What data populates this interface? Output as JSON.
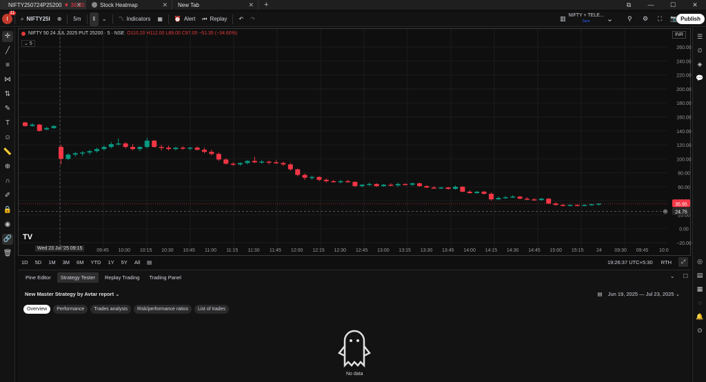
{
  "browser": {
    "tabs": [
      {
        "label": "NIFTY250724P25200",
        "price": "▼ 36.20",
        "active": true
      },
      {
        "label": "Stock Heatmap",
        "active": false
      },
      {
        "label": "New Tab",
        "active": false
      }
    ],
    "new_tab": "+"
  },
  "toolbar": {
    "avatar_letter": "I",
    "notifications": "11",
    "symbol": "NIFTY25I",
    "interval": "5m",
    "indicators": "Indicators",
    "alert": "Alert",
    "replay": "Replay",
    "layout_name": "NIFTY + TELE...",
    "layout_sub": "Save",
    "publish": "Publish"
  },
  "chart": {
    "legend_title": "NIFTY 50 24 JUL 2025 PUT 25200 · 5 · NSE",
    "ohlc": "O110.20 H112.00 L89.00 C97.05 −51.35 (−34.60%)",
    "interval_box": "5",
    "currency": "INR",
    "price_labels": [
      "260.00",
      "240.00",
      "220.00",
      "200.00",
      "180.00",
      "160.00",
      "140.00",
      "120.00",
      "100.00",
      "80.00",
      "60.00",
      "40.00",
      "20.00",
      "0.00",
      "−20.00"
    ],
    "last_price": "35.95",
    "crosshair_price": "24.75",
    "time_labels": [
      "09:45",
      "10:00",
      "10:15",
      "10:30",
      "10:45",
      "11:00",
      "11:15",
      "11:30",
      "11:45",
      "12:00",
      "12:15",
      "12:30",
      "12:45",
      "13:00",
      "13:15",
      "13:30",
      "13:45",
      "14:00",
      "14:15",
      "14:30",
      "14:45",
      "15:00",
      "15:15",
      "24",
      "09:30",
      "09:45",
      "10:0"
    ],
    "crosshair_date": "Wed 23 Jul '25   09:15",
    "colors": {
      "up": "#089981",
      "down": "#f23645"
    }
  },
  "chart_data": {
    "type": "candlestick",
    "ylim": [
      -20,
      270
    ],
    "candles": [
      [
        152,
        153,
        146,
        147,
        "d"
      ],
      [
        147,
        151,
        146,
        149,
        "u"
      ],
      [
        149,
        150,
        139,
        140,
        "d"
      ],
      [
        142,
        146,
        141,
        144,
        "u"
      ],
      [
        144,
        148,
        143,
        147,
        "u"
      ],
      [
        117,
        120,
        92,
        100,
        "d"
      ],
      [
        100,
        108,
        98,
        106,
        "u"
      ],
      [
        106,
        110,
        103,
        108,
        "u"
      ],
      [
        108,
        111,
        104,
        109,
        "u"
      ],
      [
        109,
        113,
        106,
        111,
        "u"
      ],
      [
        111,
        116,
        109,
        114,
        "u"
      ],
      [
        114,
        119,
        112,
        117,
        "u"
      ],
      [
        117,
        124,
        115,
        121,
        "u"
      ],
      [
        121,
        129,
        119,
        122,
        "u"
      ],
      [
        122,
        124,
        115,
        117,
        "d"
      ],
      [
        117,
        121,
        112,
        114,
        "d"
      ],
      [
        114,
        118,
        111,
        117,
        "u"
      ],
      [
        117,
        130,
        115,
        126,
        "u"
      ],
      [
        126,
        127,
        116,
        117,
        "d"
      ],
      [
        117,
        120,
        112,
        116,
        "d"
      ],
      [
        116,
        119,
        112,
        114,
        "d"
      ],
      [
        114,
        117,
        112,
        116,
        "u"
      ],
      [
        116,
        118,
        113,
        115,
        "d"
      ],
      [
        115,
        117,
        112,
        116,
        "u"
      ],
      [
        116,
        118,
        112,
        113,
        "d"
      ],
      [
        113,
        116,
        108,
        110,
        "d"
      ],
      [
        110,
        113,
        105,
        107,
        "d"
      ],
      [
        107,
        109,
        97,
        99,
        "d"
      ],
      [
        99,
        101,
        92,
        93,
        "d"
      ],
      [
        93,
        95,
        90,
        92,
        "d"
      ],
      [
        92,
        95,
        90,
        94,
        "u"
      ],
      [
        94,
        98,
        92,
        97,
        "u"
      ],
      [
        97,
        103,
        94,
        95,
        "d"
      ],
      [
        95,
        98,
        93,
        96,
        "u"
      ],
      [
        96,
        97,
        92,
        95,
        "d"
      ],
      [
        95,
        98,
        93,
        94,
        "d"
      ],
      [
        94,
        96,
        90,
        92,
        "d"
      ],
      [
        92,
        94,
        83,
        85,
        "d"
      ],
      [
        85,
        86,
        75,
        77,
        "d"
      ],
      [
        77,
        79,
        70,
        73,
        "d"
      ],
      [
        73,
        76,
        70,
        74,
        "u"
      ],
      [
        74,
        75,
        68,
        70,
        "d"
      ],
      [
        70,
        72,
        66,
        68,
        "d"
      ],
      [
        68,
        70,
        66,
        67,
        "d"
      ],
      [
        67,
        70,
        65,
        68,
        "u"
      ],
      [
        68,
        70,
        66,
        67,
        "d"
      ],
      [
        67,
        68,
        60,
        61,
        "d"
      ],
      [
        61,
        64,
        59,
        63,
        "u"
      ],
      [
        63,
        66,
        61,
        64,
        "u"
      ],
      [
        64,
        65,
        60,
        61,
        "d"
      ],
      [
        61,
        64,
        60,
        63,
        "u"
      ],
      [
        63,
        65,
        61,
        62,
        "d"
      ],
      [
        62,
        66,
        60,
        64,
        "u"
      ],
      [
        64,
        65,
        62,
        63,
        "d"
      ],
      [
        63,
        66,
        61,
        65,
        "u"
      ],
      [
        65,
        66,
        60,
        61,
        "d"
      ],
      [
        61,
        62,
        58,
        59,
        "d"
      ],
      [
        59,
        61,
        57,
        58,
        "d"
      ],
      [
        58,
        60,
        57,
        59,
        "u"
      ],
      [
        59,
        60,
        56,
        57,
        "d"
      ],
      [
        57,
        62,
        56,
        60,
        "u"
      ],
      [
        60,
        61,
        52,
        53,
        "d"
      ],
      [
        53,
        55,
        50,
        51,
        "d"
      ],
      [
        51,
        54,
        50,
        53,
        "u"
      ],
      [
        53,
        54,
        49,
        50,
        "d"
      ],
      [
        50,
        52,
        40,
        42,
        "d"
      ],
      [
        42,
        46,
        41,
        44,
        "u"
      ],
      [
        44,
        47,
        43,
        45,
        "u"
      ],
      [
        45,
        48,
        44,
        46,
        "u"
      ],
      [
        46,
        47,
        42,
        43,
        "d"
      ],
      [
        43,
        45,
        41,
        42,
        "d"
      ],
      [
        42,
        44,
        40,
        41,
        "d"
      ],
      [
        41,
        44,
        40,
        43,
        "u"
      ],
      [
        43,
        44,
        35,
        36,
        "d"
      ],
      [
        36,
        38,
        33,
        34,
        "d"
      ],
      [
        34,
        36,
        32,
        33,
        "d"
      ],
      [
        33,
        35,
        32,
        34,
        "u"
      ],
      [
        34,
        35,
        32,
        33,
        "d"
      ],
      [
        33,
        35,
        32,
        34,
        "u"
      ],
      [
        34,
        36,
        33,
        35,
        "u"
      ],
      [
        35,
        36,
        33,
        35.95,
        "u"
      ]
    ]
  },
  "range_bar": {
    "ranges": [
      "1D",
      "5D",
      "1M",
      "3M",
      "6M",
      "YTD",
      "1Y",
      "5Y",
      "All"
    ],
    "clock": "19:26:37 UTC+5:30",
    "session": "RTH"
  },
  "bottom": {
    "tabs": [
      "Pine Editor",
      "Strategy Tester",
      "Replay Trading",
      "Trading Panel"
    ],
    "active_tab": 1,
    "strategy_name": "New Master Strategy by Avtar report",
    "date_range": "Jun 19, 2025 — Jul 23, 2025",
    "pills": [
      "Overview",
      "Performance",
      "Trades analysis",
      "Risk/performance ratios",
      "List of trades"
    ],
    "no_data": "No data"
  }
}
